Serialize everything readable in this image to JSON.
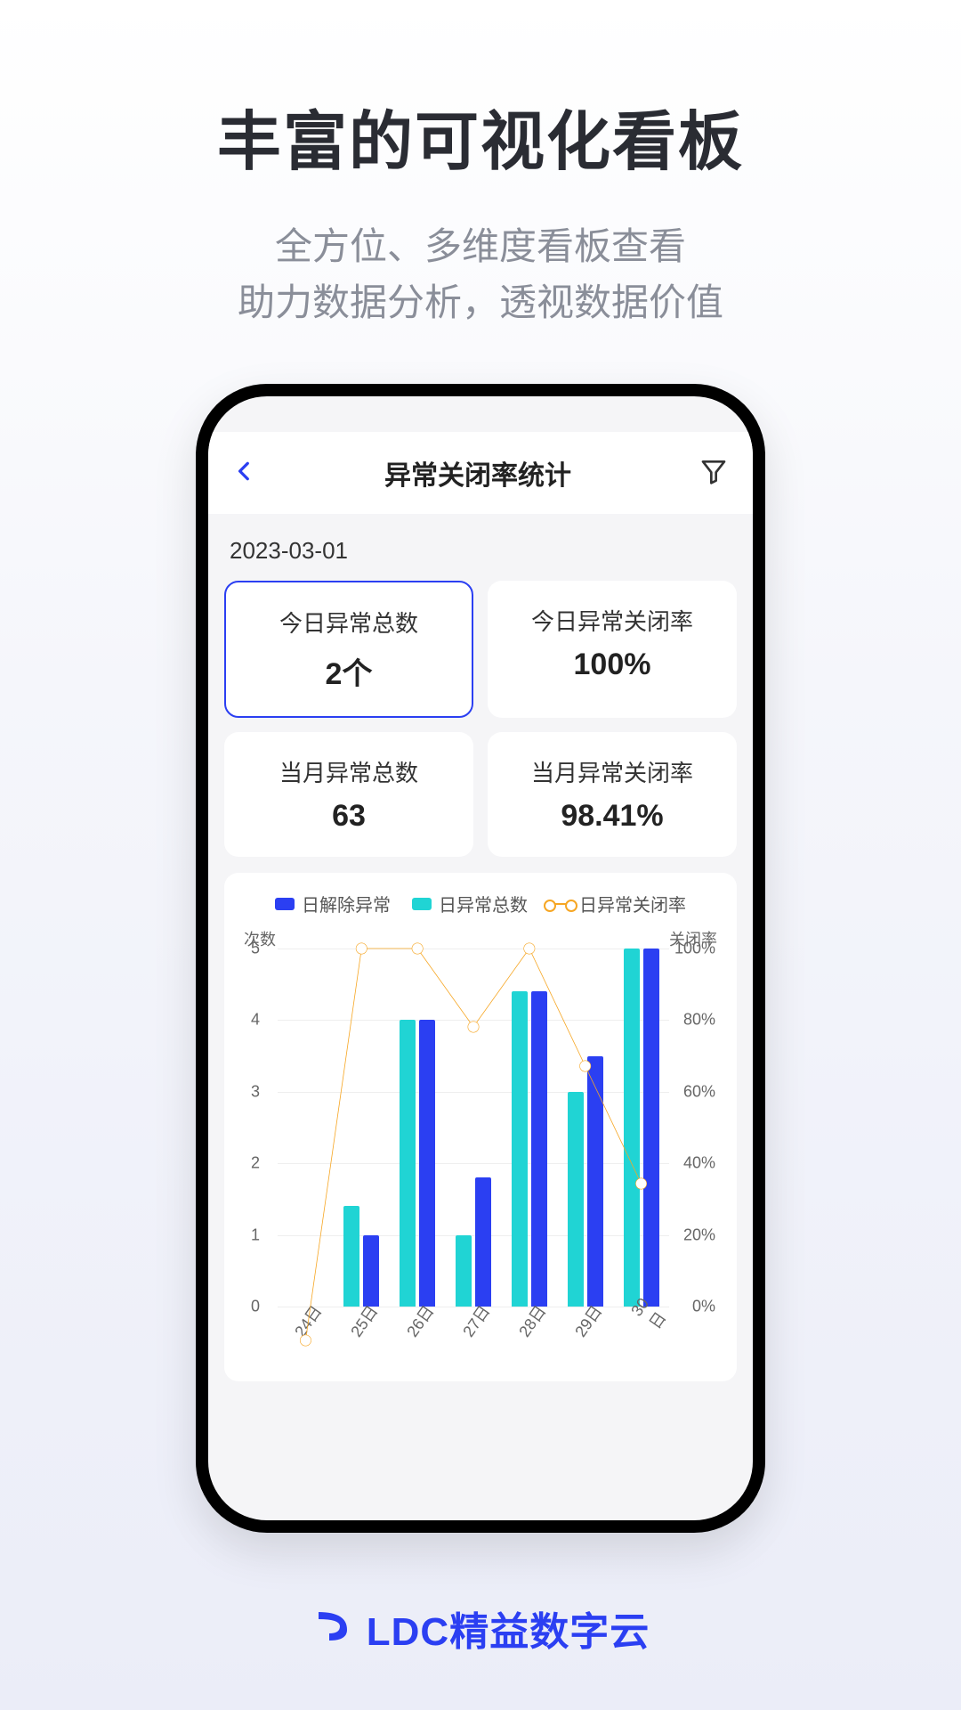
{
  "hero": {
    "title": "丰富的可视化看板",
    "sub1": "全方位、多维度看板查看",
    "sub2": "助力数据分析，透视数据价值"
  },
  "nav": {
    "title": "异常关闭率统计"
  },
  "date": "2023-03-01",
  "cards": [
    {
      "label": "今日异常总数",
      "value": "2个",
      "selected": true
    },
    {
      "label": "今日异常关闭率",
      "value": "100%",
      "selected": false
    },
    {
      "label": "当月异常总数",
      "value": "63",
      "selected": false
    },
    {
      "label": "当月异常关闭率",
      "value": "98.41%",
      "selected": false
    }
  ],
  "legend": {
    "s1": "日解除异常",
    "s2": "日异常总数",
    "s3": "日异常关闭率"
  },
  "axis": {
    "left_title": "次数",
    "right_title": "关闭率"
  },
  "colors": {
    "s1": "#2b3ff2",
    "s2": "#20d4d4",
    "line": "#f6a623"
  },
  "chart_data": {
    "type": "bar",
    "categories": [
      "24日",
      "25日",
      "26日",
      "27日",
      "28日",
      "29日",
      "30日"
    ],
    "ylabel": "次数",
    "ylim": [
      0,
      5
    ],
    "y2label": "关闭率",
    "y2lim": [
      0,
      100
    ],
    "y_ticks": [
      0,
      1,
      2,
      3,
      4,
      5
    ],
    "y2_ticks": [
      "0%",
      "20%",
      "40%",
      "60%",
      "80%",
      "100%"
    ],
    "series": [
      {
        "name": "日解除异常",
        "values": [
          0,
          1,
          4,
          1.8,
          4.4,
          3.5,
          5
        ]
      },
      {
        "name": "日异常总数",
        "values": [
          0,
          1.4,
          4,
          1,
          4.4,
          3,
          5
        ]
      }
    ],
    "line_series": {
      "name": "日异常关闭率",
      "values": [
        0,
        100,
        100,
        80,
        100,
        70,
        40
      ]
    }
  },
  "footer": {
    "brand": "LDC精益数字云"
  }
}
